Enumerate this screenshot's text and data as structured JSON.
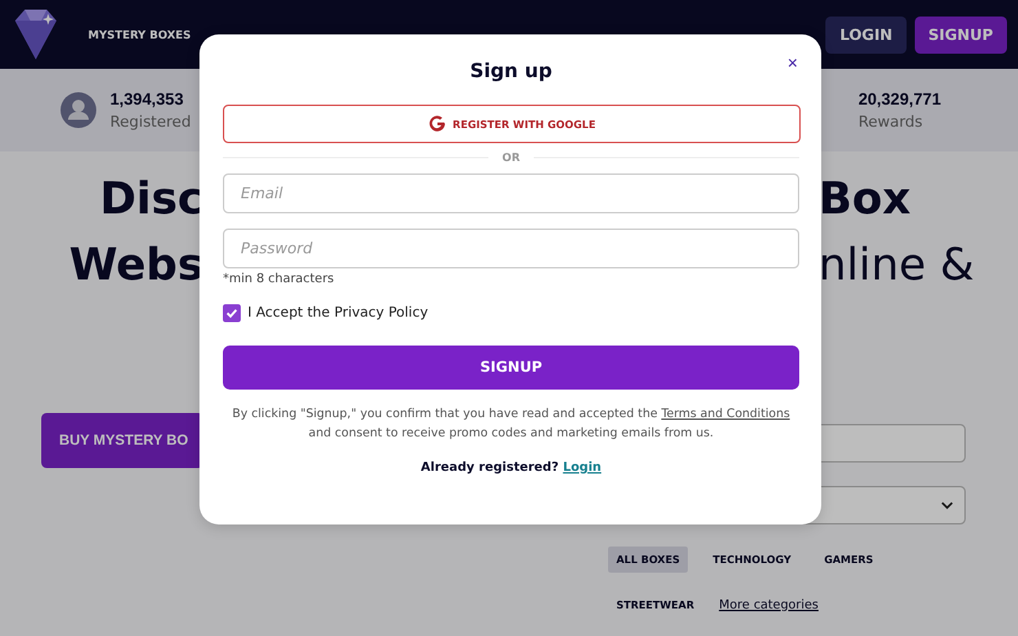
{
  "nav": {
    "items": [
      {
        "label": "MYSTERY BOXES"
      }
    ],
    "login": "LOGIN",
    "signup": "SIGNUP"
  },
  "stats": [
    {
      "value": "1,394,353",
      "label": "Registered"
    },
    {
      "value": "20,329,771",
      "label": "Rewards"
    }
  ],
  "hero": {
    "lines": [
      {
        "left": "Disc",
        "right": "Box"
      },
      {
        "left": "Webs",
        "right": "nline &"
      }
    ],
    "buy_button": "BUY MYSTERY BO"
  },
  "categories": [
    {
      "label": "ALL BOXES",
      "selected": true
    },
    {
      "label": "TECHNOLOGY",
      "selected": false
    },
    {
      "label": "GAMERS",
      "selected": false
    },
    {
      "label": "STREETWEAR",
      "selected": false
    }
  ],
  "more_categories": "More categories",
  "modal": {
    "title": "Sign up",
    "close": "×",
    "google_button": "REGISTER WITH GOOGLE",
    "divider": "OR",
    "email": {
      "placeholder": "Email"
    },
    "password": {
      "placeholder": "Password"
    },
    "password_hint": "*min 8 characters",
    "privacy": {
      "label": "I Accept the Privacy Policy",
      "checked": true
    },
    "submit": "SIGNUP",
    "consent": {
      "before": "By clicking \"Signup,\" you confirm that you have read and accepted the",
      "link": "Terms and Conditions",
      "after": "and consent to receive promo codes and marketing emails from us."
    },
    "already": {
      "text": "Already registered?",
      "link": "Login"
    }
  }
}
